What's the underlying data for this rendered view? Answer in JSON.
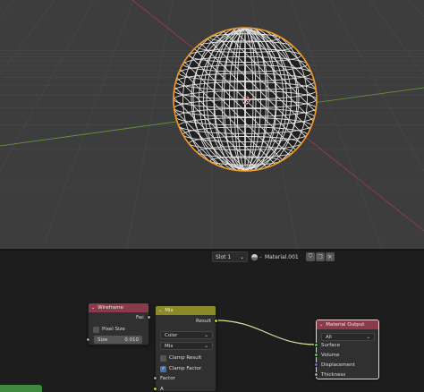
{
  "viewport": {
    "background": "#3d3d3d",
    "grid_color": "#4a4a4a",
    "x_axis_color": "#9c3c4a",
    "y_axis_color": "#6c9c3a",
    "object": {
      "name": "sphere",
      "display": "wireframe",
      "wire_color": "#e2e2e2",
      "fill_color": "#202020",
      "outline_color": "#f39c28",
      "selected": true
    }
  },
  "header": {
    "slot": "Slot 1",
    "material_type_icon": "material-sphere-icon",
    "material_name": "Material.001",
    "buttons": [
      {
        "icon": "shield-icon",
        "label": "⛉"
      },
      {
        "icon": "duplicate-icon",
        "label": "❐"
      },
      {
        "icon": "close-icon",
        "label": "✕"
      }
    ],
    "pin_icon": "pin-icon"
  },
  "nodes": {
    "wireframe": {
      "title": "Wireframe",
      "header_color": "#8a3a4a",
      "output": "Fac",
      "pixel_size_label": "Pixel Size",
      "pixel_size_checked": false,
      "size_label": "Size",
      "size_value": "0.010"
    },
    "mix": {
      "title": "Mix",
      "header_color": "#8a8a26",
      "output": "Result",
      "data_type": "Color",
      "blend_mode": "Mix",
      "clamp_result_label": "Clamp Result",
      "clamp_result_checked": false,
      "clamp_factor_label": "Clamp Factor",
      "clamp_factor_checked": true,
      "input_factor": "Factor",
      "input_a": "A"
    },
    "material_output": {
      "title": "Material Output",
      "header_color": "#8a3a4a",
      "target": "All",
      "inputs": [
        "Surface",
        "Volume",
        "Displacement",
        "Thickness"
      ]
    }
  },
  "editor_background": "#1d1d1d",
  "wire_color": "#e0e0a0"
}
